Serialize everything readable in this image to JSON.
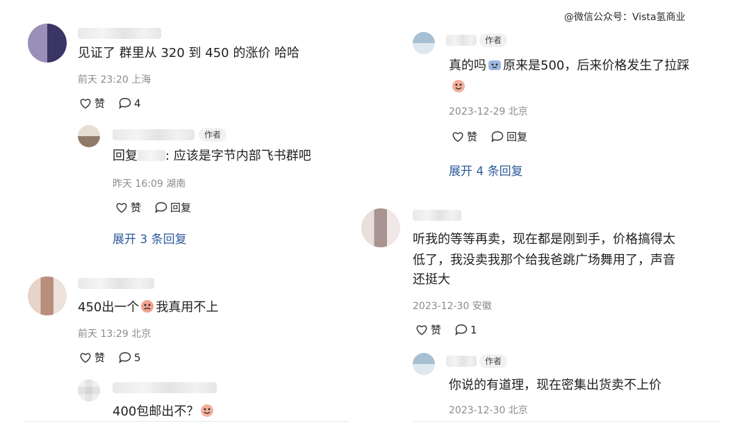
{
  "watermark": "@微信公众号：Vista氢商业",
  "common": {
    "like": "赞",
    "reply": "回复",
    "author_tag": "作者"
  },
  "left": {
    "c1": {
      "text": "见证了 群里从 320 到 450 的涨价 哈哈",
      "meta": "前天 23:20 上海",
      "reply_count": "4"
    },
    "c1_reply": {
      "prefix": "回复",
      "rest": ": 应该是字节内部飞书群吧",
      "meta": "昨天 16:09 湖南",
      "expand": "展开 3 条回复"
    },
    "c2": {
      "text_before": "450出一个",
      "text_after": "我真用不上",
      "meta": "前天 13:29 北京",
      "reply_count": "5"
    },
    "c2_reply": {
      "text": "400包邮出不？"
    }
  },
  "right": {
    "r1": {
      "text_before": "真的吗",
      "text_after": "原来是500，后来价格发生了拉踩",
      "meta": "2023-12-29 北京",
      "expand": "展开 4 条回复"
    },
    "r2": {
      "lines": [
        "听我的等等再卖，现在都是刚到手，价格搞得太",
        "低了，我没卖我那个给我爸跳广场舞用了，声音",
        "还挺大"
      ],
      "meta": "2023-12-30 安徽",
      "reply_count": "1"
    },
    "r2_reply": {
      "text": "你说的有道理，现在密集出货卖不上价",
      "meta": "2023-12-30 北京"
    }
  }
}
